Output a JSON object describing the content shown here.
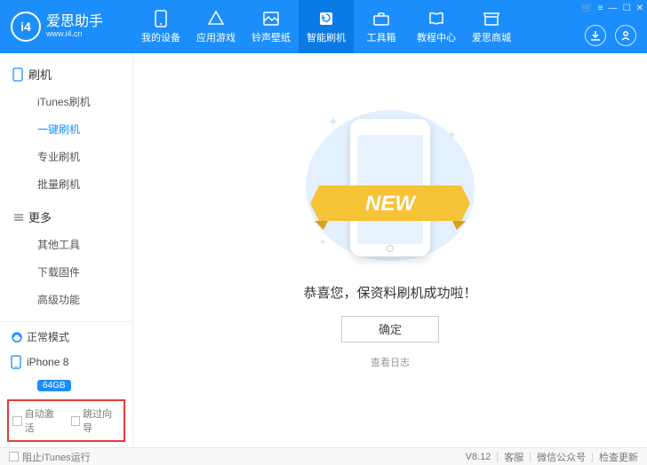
{
  "app": {
    "name": "爱思助手",
    "url": "www.i4.cn"
  },
  "nav": [
    {
      "label": "我的设备"
    },
    {
      "label": "应用游戏"
    },
    {
      "label": "铃声壁纸"
    },
    {
      "label": "智能刷机"
    },
    {
      "label": "工具箱"
    },
    {
      "label": "教程中心"
    },
    {
      "label": "爱思商城"
    }
  ],
  "sidebar": {
    "group1": {
      "title": "刷机",
      "items": [
        "iTunes刷机",
        "一键刷机",
        "专业刷机",
        "批量刷机"
      ],
      "selected": 1
    },
    "group2": {
      "title": "更多",
      "items": [
        "其他工具",
        "下载固件",
        "高级功能"
      ]
    },
    "mode": "正常模式",
    "device": {
      "name": "iPhone 8",
      "storage": "64GB"
    },
    "options": {
      "autoActivate": "自动激活",
      "skipGuide": "跳过向导"
    }
  },
  "main": {
    "ribbon": "NEW",
    "message": "恭喜您，保资料刷机成功啦！",
    "okLabel": "确定",
    "logLink": "查看日志"
  },
  "footer": {
    "blockItunes": "阻止iTunes运行",
    "version": "V8.12",
    "links": [
      "客服",
      "微信公众号",
      "检查更新"
    ]
  }
}
